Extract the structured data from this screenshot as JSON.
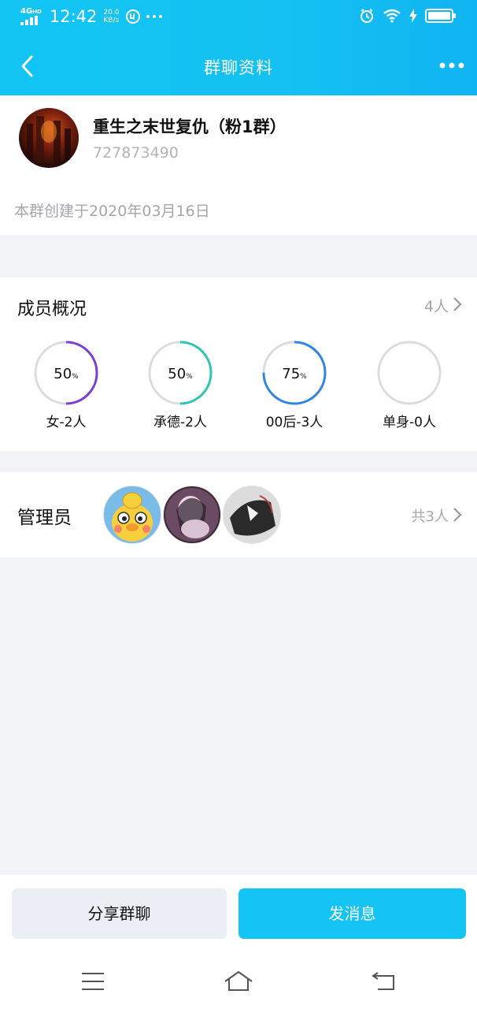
{
  "status_bar": {
    "network": "4G",
    "network_sup": "HD",
    "time": "12:42",
    "speed_value": "20.0",
    "speed_unit": "KB/s"
  },
  "header": {
    "title": "群聊资料",
    "back_icon": "chevron-left-icon",
    "more_icon": "more-dots-icon"
  },
  "group": {
    "name": "重生之末世复仇（粉1群）",
    "id": "727873490",
    "created": "本群创建于2020年03月16日"
  },
  "members": {
    "title": "成员概况",
    "count": "4人",
    "stats": [
      {
        "percent": 50,
        "number": "50",
        "unit": "%",
        "label": "女-2人",
        "color": "#7b3fd1"
      },
      {
        "percent": 50,
        "number": "50",
        "unit": "%",
        "label": "承德-2人",
        "color": "#2ec6b2"
      },
      {
        "percent": 75,
        "number": "75",
        "unit": "%",
        "label": "00后-3人",
        "color": "#2f86e0"
      },
      {
        "percent": 0,
        "number": "",
        "unit": "",
        "label": "单身-0人",
        "color": "#2f86e0"
      }
    ]
  },
  "admins": {
    "title": "管理员",
    "count": "共3人"
  },
  "actions": {
    "share_label": "分享群聊",
    "send_label": "发消息"
  },
  "colors": {
    "header_bg": "#14c1f2",
    "accent": "#14c4f5",
    "page_bg": "#f2f3f7"
  }
}
